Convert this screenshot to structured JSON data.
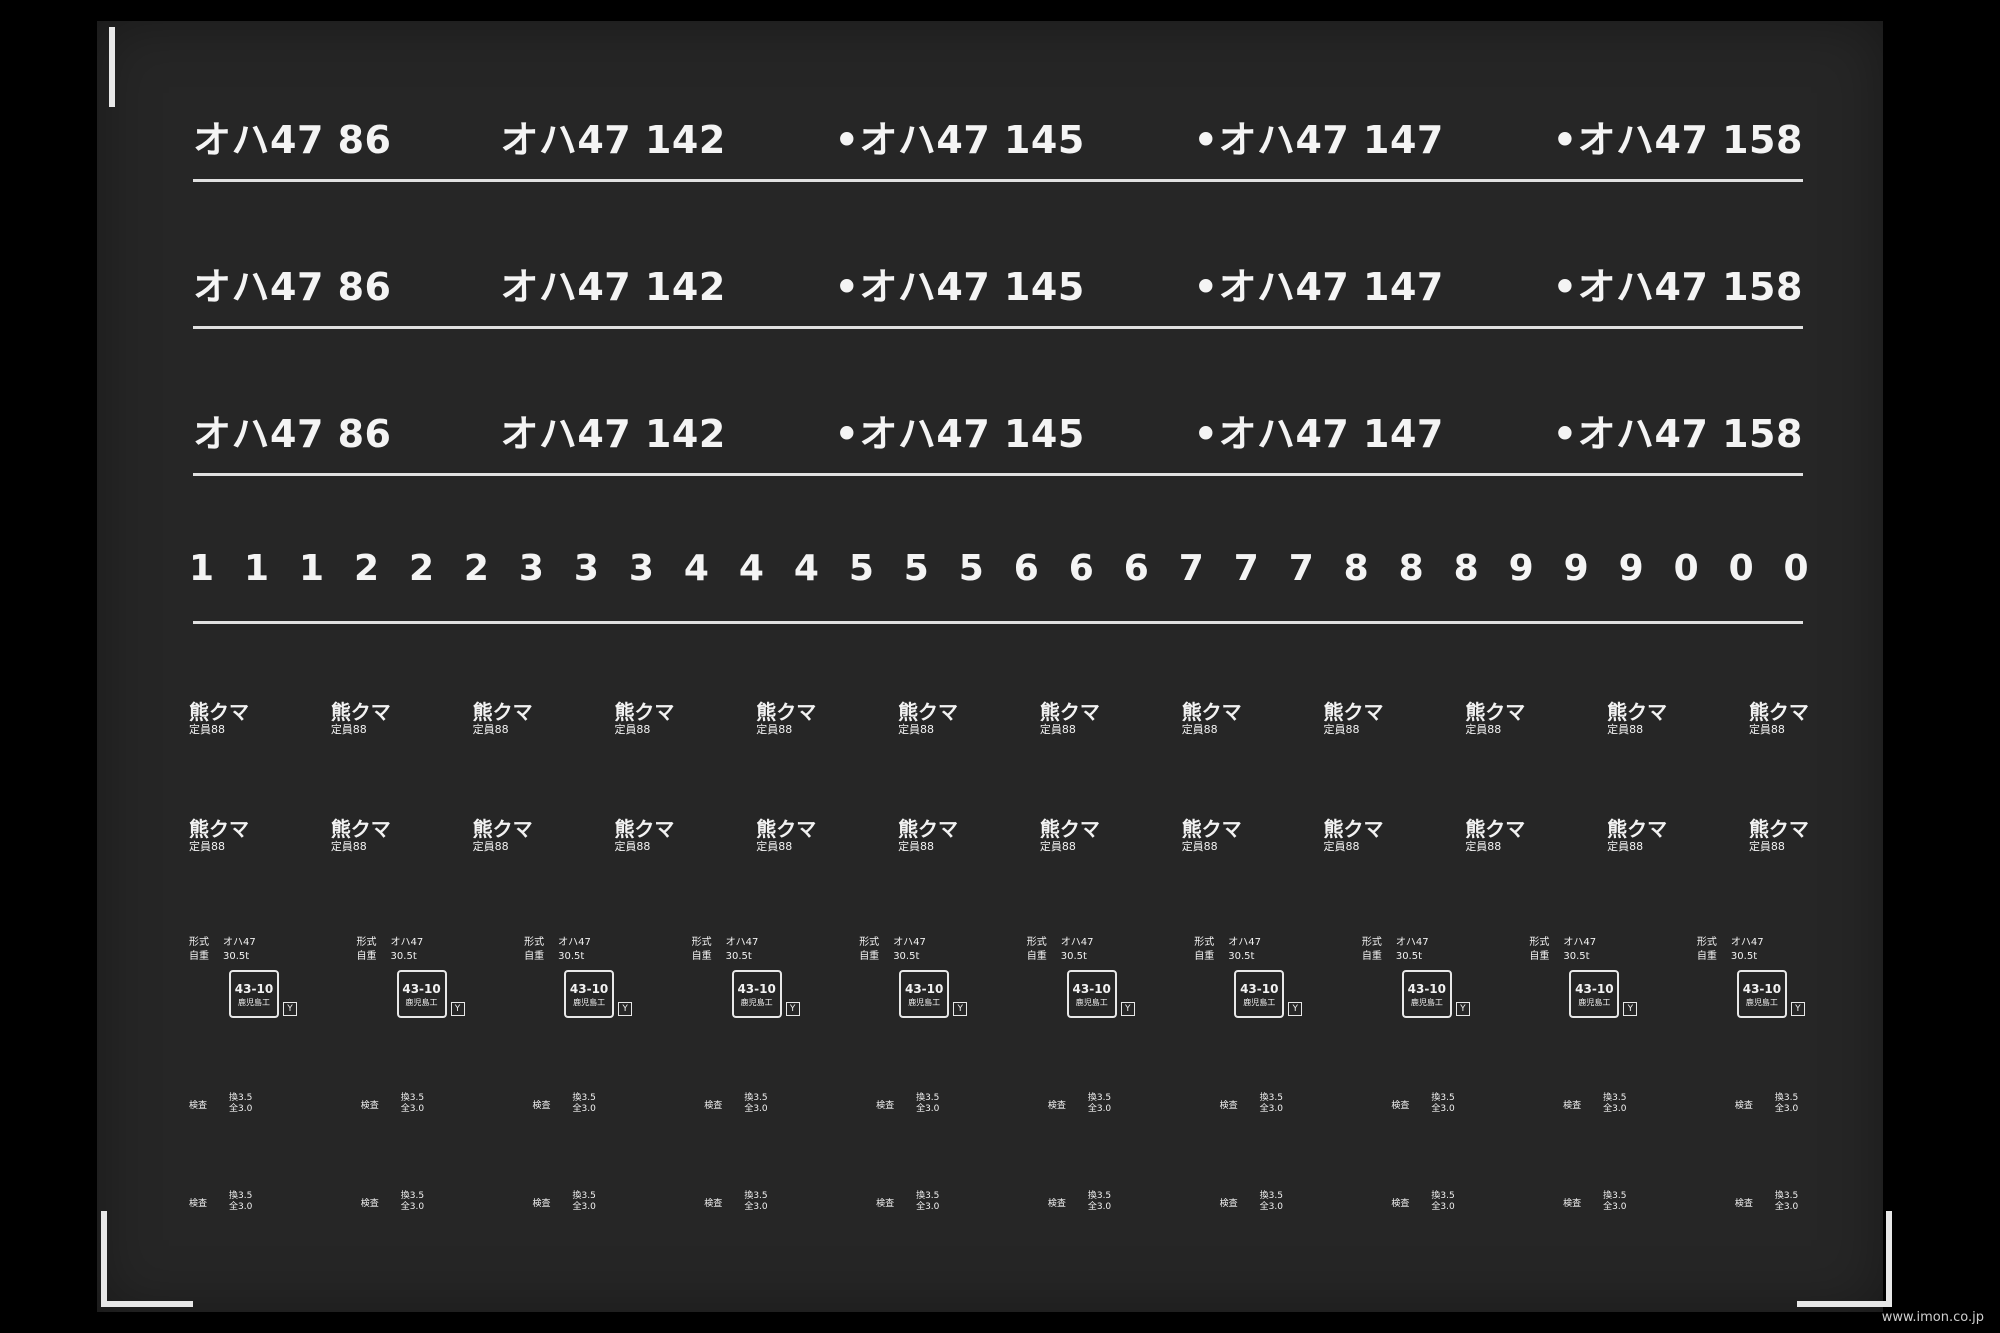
{
  "plate_rows": [
    [
      "オハ47 86",
      "オハ47 142",
      "•オハ47 145",
      "•オハ47 147",
      "•オハ47 158"
    ],
    [
      "オハ47 86",
      "オハ47 142",
      "•オハ47 145",
      "•オハ47 147",
      "•オハ47 158"
    ],
    [
      "オハ47 86",
      "オハ47 142",
      "•オハ47 145",
      "•オハ47 147",
      "•オハ47 158"
    ]
  ],
  "digits": [
    "1",
    "1",
    "1",
    "2",
    "2",
    "2",
    "3",
    "3",
    "3",
    "4",
    "4",
    "4",
    "5",
    "5",
    "5",
    "6",
    "6",
    "6",
    "7",
    "7",
    "7",
    "8",
    "8",
    "8",
    "9",
    "9",
    "9",
    "0",
    "0",
    "0"
  ],
  "depot_label": {
    "line1": "熊クマ",
    "line2": "定員88"
  },
  "spec_label": {
    "type_key": "形式",
    "type_val": "オハ47",
    "weight_key": "自重",
    "weight_val": "30.5t",
    "box_top": "43-10",
    "box_bottom": "鹿児島工",
    "tag": "Y"
  },
  "insp_label": {
    "key": "検査",
    "v1": "換3.5",
    "v2": "全3.0"
  },
  "watermark": "www.imon.co.jp",
  "colors": {
    "sheet": "#262626",
    "print": "#f2f2f2",
    "background": "#000000"
  }
}
